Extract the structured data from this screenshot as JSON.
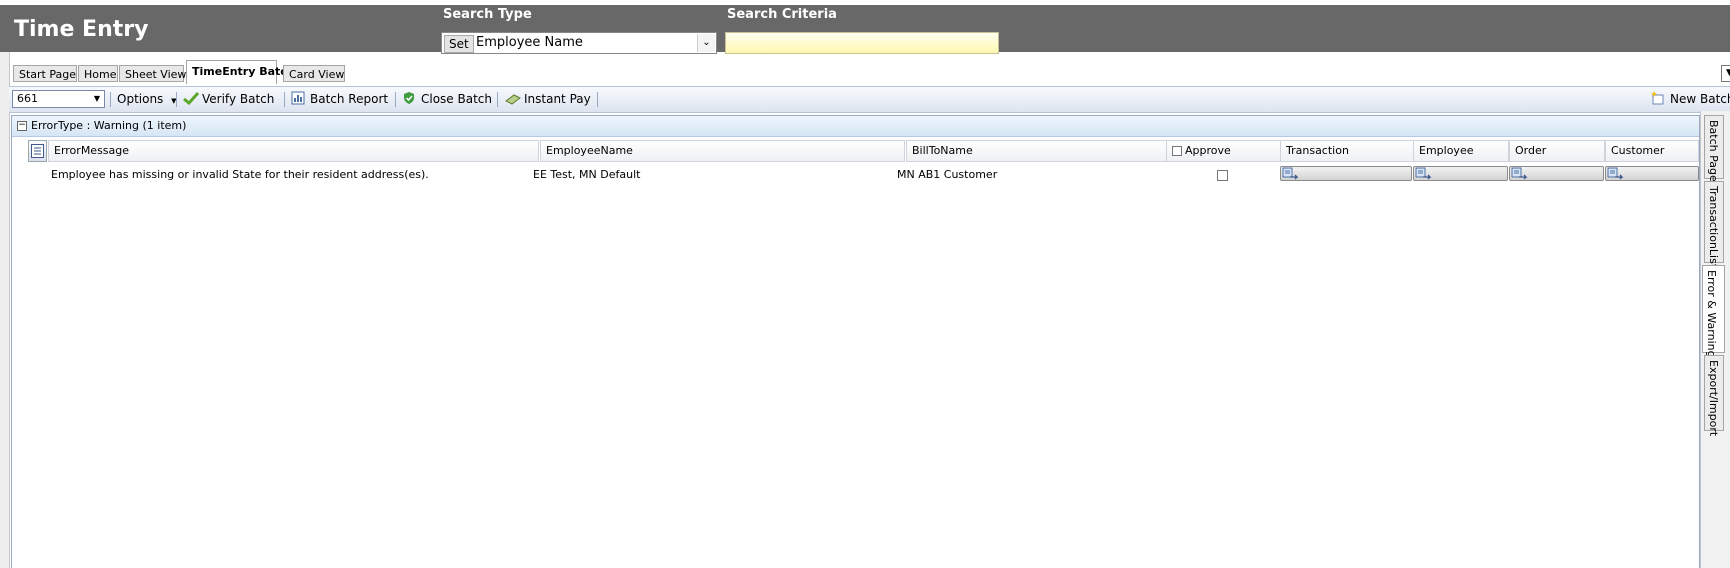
{
  "app": {
    "title": "Time Entry"
  },
  "search": {
    "type_label": "Search Type",
    "set_label": "Set",
    "type_value": "Employee Name",
    "criteria_label": "Search Criteria",
    "criteria_value": ""
  },
  "tabs": [
    {
      "label": "Start Page"
    },
    {
      "label": "Home"
    },
    {
      "label": "Sheet View"
    },
    {
      "label": "TimeEntry Batch",
      "active": true
    },
    {
      "label": "Card View"
    }
  ],
  "toolbar": {
    "batch_number": "661",
    "options_label": "Options",
    "verify_label": "Verify Batch",
    "report_label": "Batch Report",
    "close_label": "Close Batch",
    "instant_pay_label": "Instant Pay",
    "new_batch_label": "New Batch"
  },
  "grid": {
    "group_label": "ErrorType : Warning (1 item)",
    "columns": {
      "error_message": "ErrorMessage",
      "employee_name": "EmployeeName",
      "bill_to_name": "BillToName",
      "approve": "Approve",
      "transaction": "Transaction",
      "employee": "Employee",
      "order": "Order",
      "customer": "Customer"
    },
    "rows": [
      {
        "error_message": "Employee has missing or invalid State for their resident address(es).",
        "employee_name": "EE Test, MN Default",
        "bill_to_name": "MN AB1 Customer",
        "approve": false
      }
    ]
  },
  "side_tabs": [
    {
      "label": "Batch Page"
    },
    {
      "label": "TransactionList"
    },
    {
      "label": "Error & Warning",
      "active": true
    },
    {
      "label": "Export/Import"
    }
  ],
  "colors": {
    "header_bg": "#686868",
    "criteria_bg": "#fdf7b0",
    "toolbar_bg": "#dde4f0",
    "group_bg": "#d6e6f6"
  }
}
